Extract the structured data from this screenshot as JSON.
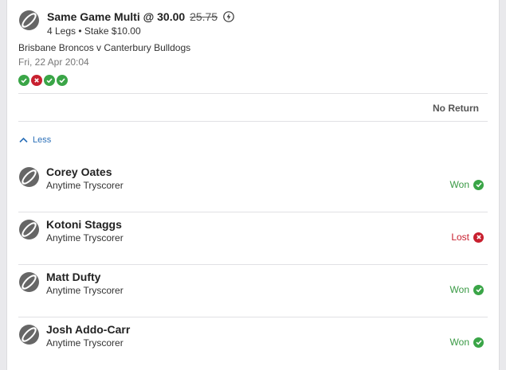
{
  "bet": {
    "title": "Same Game Multi @ 30.00",
    "old_odds": "25.75",
    "legs_stake": "4 Legs • Stake $10.00",
    "match": "Brisbane Broncos v Canterbury Bulldogs",
    "date": "Fri, 22 Apr 20:04",
    "leg_status_dots": [
      "won",
      "lost",
      "won",
      "won"
    ],
    "return_label": "No Return",
    "toggle_label": "Less"
  },
  "legs": [
    {
      "name": "Corey Oates",
      "market": "Anytime Tryscorer",
      "result": "Won"
    },
    {
      "name": "Kotoni Staggs",
      "market": "Anytime Tryscorer",
      "result": "Lost"
    },
    {
      "name": "Matt Dufty",
      "market": "Anytime Tryscorer",
      "result": "Won"
    },
    {
      "name": "Josh Addo-Carr",
      "market": "Anytime Tryscorer",
      "result": "Won"
    }
  ],
  "colors": {
    "won": "#3aa547",
    "lost": "#c8202f",
    "link": "#2a6fb8"
  },
  "icons": {
    "sport": "rugby-ball-icon",
    "won": "check-circle-icon",
    "lost": "cross-circle-icon",
    "boost": "lightning-icon",
    "toggle": "chevron-up-icon"
  }
}
